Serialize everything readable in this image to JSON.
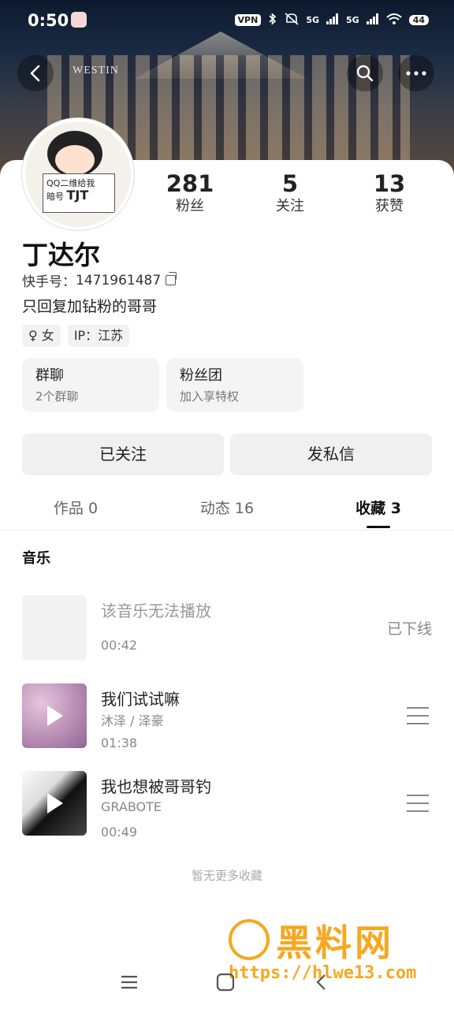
{
  "status": {
    "time": "0:50",
    "vpn": "VPN",
    "net1": "5G",
    "net2": "5G",
    "battery": "44"
  },
  "header": {
    "brand_sign": "WESTIN"
  },
  "avatar": {
    "card_line1": "QQ二维",
    "card_line1b": "给我",
    "card_line2": "暗号",
    "card_line2b": "TJT"
  },
  "stats": [
    {
      "value": "281",
      "label": "粉丝"
    },
    {
      "value": "5",
      "label": "关注"
    },
    {
      "value": "13",
      "label": "获赞"
    }
  ],
  "profile": {
    "name": "丁达尔",
    "kuaishou_id_label": "快手号：",
    "kuaishou_id": "1471961487",
    "bio": "只回复加钻粉的哥哥",
    "tags": [
      "♀ 女",
      "IP：江苏"
    ]
  },
  "cards": [
    {
      "title": "群聊",
      "subtitle": "2个群聊"
    },
    {
      "title": "粉丝团",
      "subtitle": "加入享特权"
    }
  ],
  "actions": {
    "followed": "已关注",
    "message": "发私信"
  },
  "tabs": [
    {
      "label": "作品 0"
    },
    {
      "label": "动态 16"
    },
    {
      "label": "收藏 3",
      "active": true
    }
  ],
  "section_title": "音乐",
  "songs": [
    {
      "title": "该音乐无法播放",
      "artist": "",
      "duration": "00:42",
      "status": "已下线"
    },
    {
      "title": "我们试试嘛",
      "artist": "沐泽 / 泽豪",
      "duration": "01:38",
      "status": ""
    },
    {
      "title": "我也想被哥哥钓",
      "artist": "GRABOTE",
      "duration": "00:49",
      "status": ""
    }
  ],
  "no_more": "暂无更多收藏",
  "watermark": {
    "text": "黑料网",
    "url": "https://hlwe13.com"
  }
}
